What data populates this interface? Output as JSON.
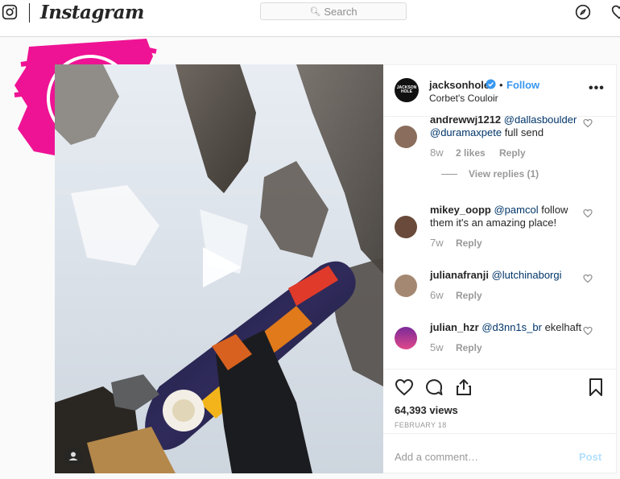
{
  "header": {
    "wordmark": "Instagram",
    "search_placeholder": "Search"
  },
  "post": {
    "owner": "jacksonhole",
    "avatar_text": "JACKSON HOLE",
    "follow_label": "Follow",
    "separator": "•",
    "location": "Corbet's Couloir",
    "more_label": "•••",
    "views": "64,393 views",
    "date": "FEBRUARY 18"
  },
  "comments": [
    {
      "user": "andrewwj1212",
      "mention": "@dallasboulder @duramaxpete",
      "text": " full send",
      "age": "8w",
      "likes": "2 likes",
      "reply": "Reply"
    },
    {
      "user": "mikey_oopp",
      "mention": "@pamcol",
      "text": " follow them it's an amazing place!",
      "age": "7w",
      "reply": "Reply"
    },
    {
      "user": "julianafranji",
      "mention": "@lutchinaborgi",
      "text": "",
      "age": "6w",
      "reply": "Reply"
    },
    {
      "user": "julian_hzr",
      "mention": "@d3nn1s_br",
      "text": " ekelhaft",
      "age": "5w",
      "reply": "Reply"
    }
  ],
  "view_replies": "View replies (1)",
  "add_comment": {
    "placeholder": "Add a comment…",
    "post_label": "Post"
  },
  "colors": {
    "accent": "#3897f0",
    "sticker": "#ee1394",
    "link": "#003569"
  }
}
